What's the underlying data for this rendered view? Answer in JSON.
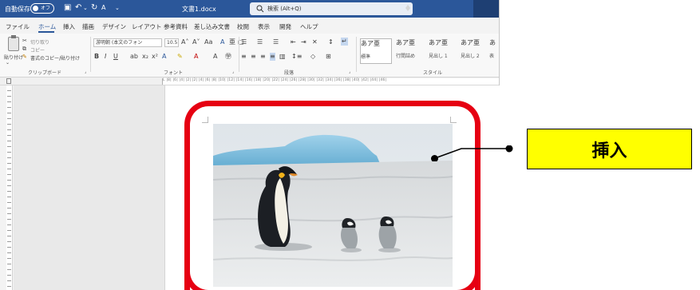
{
  "titlebar": {
    "autosave_label": "自動保存",
    "autosave_state": "オフ",
    "document_title": "文書1.docx",
    "search_placeholder": "検索 (Alt+Q)"
  },
  "tabs": [
    "ファイル",
    "ホーム",
    "挿入",
    "描画",
    "デザイン",
    "レイアウト",
    "参考資料",
    "差し込み文書",
    "校閲",
    "表示",
    "開発",
    "ヘルプ"
  ],
  "active_tab": "ホーム",
  "ribbon": {
    "clipboard": {
      "paste": "貼り付け",
      "cut": "切り取り",
      "copy": "コピー",
      "format_painter": "書式のコピー/貼り付け",
      "group_label": "クリップボード"
    },
    "font": {
      "font_name": "游明朝 (本文のフォン",
      "font_size": "10.5",
      "group_label": "フォント"
    },
    "paragraph": {
      "group_label": "段落"
    },
    "styles": {
      "items": [
        {
          "sample": "あア亜",
          "name": "標準"
        },
        {
          "sample": "あア亜",
          "name": "行間詰め"
        },
        {
          "sample": "あア亜",
          "name": "見出し 1"
        },
        {
          "sample": "あア亜",
          "name": "見出し 2"
        },
        {
          "sample": "あ",
          "name": "表"
        }
      ],
      "group_label": "スタイル"
    }
  },
  "ruler_numbers": "L  |8|  |6|  |4|  |2|   |2|  |4|  |6|  |8|  |10|  |12|  |14|  |16|  |18|  |20|  |22|  |24|  |26|  |28|  |30|  |32|  |34|  |36|  |38|  |40|  |42|  |44|  |46|",
  "callout": {
    "label": "挿入"
  },
  "colors": {
    "title_bar": "#2b579a",
    "frame": "#e60012",
    "callout_fill": "#ffff00"
  }
}
